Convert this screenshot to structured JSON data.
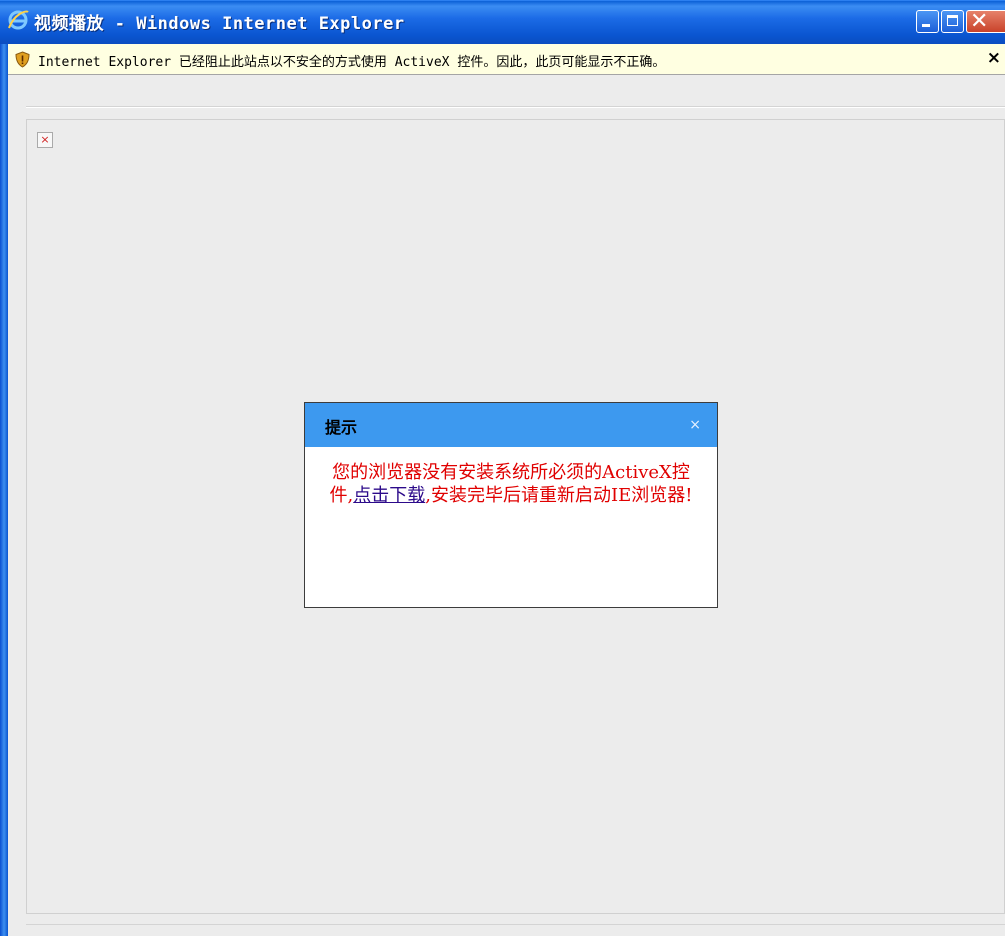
{
  "window": {
    "title": "视频播放 - Windows Internet Explorer",
    "buttons": {
      "minimize": "minimize-icon",
      "maximize": "maximize-icon",
      "close": "close-icon"
    }
  },
  "infobar": {
    "message": "Internet Explorer 已经阻止此站点以不安全的方式使用 ActiveX 控件。因此，此页可能显示不正确。",
    "close": "×"
  },
  "content": {
    "broken_image": "×"
  },
  "dialog": {
    "title": "提示",
    "close": "×",
    "message_part1": "您的浏览器没有安装系统所必须的ActiveX控件,",
    "link_text": "点击下载",
    "message_part2": ",安装完毕后请重新启动IE浏览器!"
  },
  "colors": {
    "titlebar": "#0a55d0",
    "infobar": "#ffffe1",
    "dialog_header": "#3d99ef",
    "message_text": "#e00000",
    "link": "#2c0a8a"
  }
}
